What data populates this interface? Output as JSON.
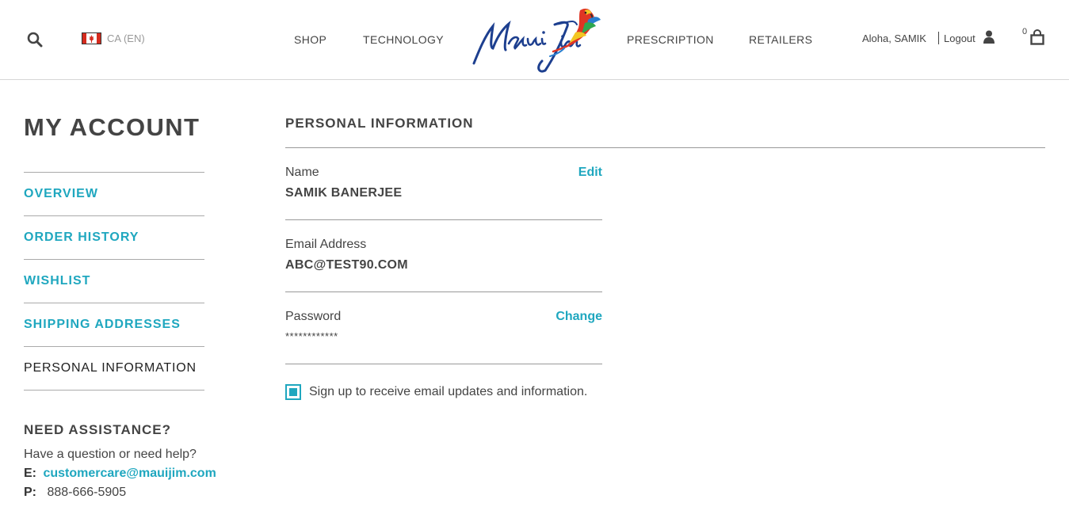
{
  "header": {
    "locale": "CA (EN)",
    "nav": {
      "shop": "SHOP",
      "technology": "TECHNOLOGY",
      "prescription": "PRESCRIPTION",
      "retailers": "RETAILERS"
    },
    "greeting": "Aloha, SAMIK",
    "logout": "Logout",
    "cart_count": "0"
  },
  "sidebar": {
    "title": "MY ACCOUNT",
    "items": [
      {
        "label": "OVERVIEW",
        "active": false
      },
      {
        "label": "ORDER HISTORY",
        "active": false
      },
      {
        "label": "WISHLIST",
        "active": false
      },
      {
        "label": "SHIPPING ADDRESSES",
        "active": false
      },
      {
        "label": "PERSONAL INFORMATION",
        "active": true
      }
    ],
    "assistance": {
      "title": "NEED ASSISTANCE?",
      "text": "Have a question or need help?",
      "email_label": "E:",
      "email": "customercare@mauijim.com",
      "phone_label": "P:",
      "phone": "888-666-5905"
    }
  },
  "main": {
    "title": "PERSONAL INFORMATION",
    "name": {
      "label": "Name",
      "value": "SAMIK BANERJEE",
      "action": "Edit"
    },
    "email": {
      "label": "Email Address",
      "value": "ABC@TEST90.COM"
    },
    "password": {
      "label": "Password",
      "value": "************",
      "action": "Change"
    },
    "newsletter": {
      "label": "Sign up to receive email updates and information.",
      "checked": true
    }
  },
  "colors": {
    "accent": "#1fa7bf",
    "text": "#444444",
    "rule": "#999999"
  }
}
